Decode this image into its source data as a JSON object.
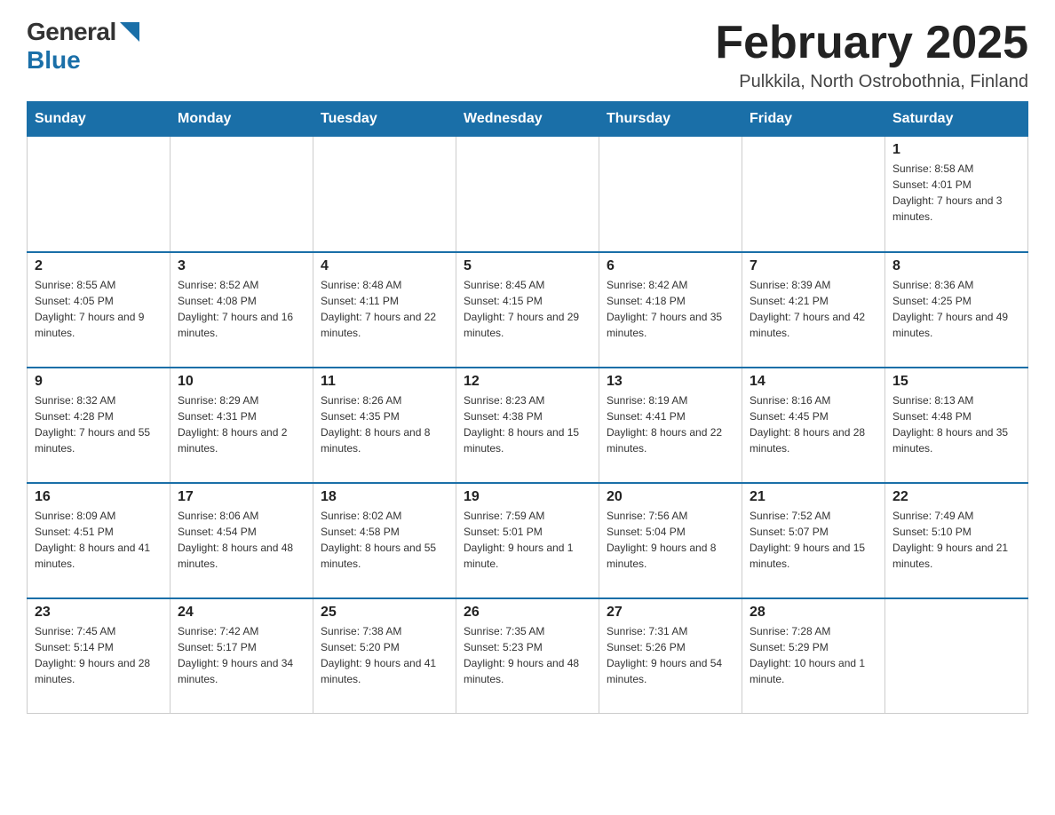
{
  "logo": {
    "general": "General",
    "blue": "Blue"
  },
  "header": {
    "title": "February 2025",
    "subtitle": "Pulkkila, North Ostrobothnia, Finland"
  },
  "weekdays": [
    "Sunday",
    "Monday",
    "Tuesday",
    "Wednesday",
    "Thursday",
    "Friday",
    "Saturday"
  ],
  "weeks": [
    [
      {
        "day": "",
        "info": ""
      },
      {
        "day": "",
        "info": ""
      },
      {
        "day": "",
        "info": ""
      },
      {
        "day": "",
        "info": ""
      },
      {
        "day": "",
        "info": ""
      },
      {
        "day": "",
        "info": ""
      },
      {
        "day": "1",
        "info": "Sunrise: 8:58 AM\nSunset: 4:01 PM\nDaylight: 7 hours and 3 minutes."
      }
    ],
    [
      {
        "day": "2",
        "info": "Sunrise: 8:55 AM\nSunset: 4:05 PM\nDaylight: 7 hours and 9 minutes."
      },
      {
        "day": "3",
        "info": "Sunrise: 8:52 AM\nSunset: 4:08 PM\nDaylight: 7 hours and 16 minutes."
      },
      {
        "day": "4",
        "info": "Sunrise: 8:48 AM\nSunset: 4:11 PM\nDaylight: 7 hours and 22 minutes."
      },
      {
        "day": "5",
        "info": "Sunrise: 8:45 AM\nSunset: 4:15 PM\nDaylight: 7 hours and 29 minutes."
      },
      {
        "day": "6",
        "info": "Sunrise: 8:42 AM\nSunset: 4:18 PM\nDaylight: 7 hours and 35 minutes."
      },
      {
        "day": "7",
        "info": "Sunrise: 8:39 AM\nSunset: 4:21 PM\nDaylight: 7 hours and 42 minutes."
      },
      {
        "day": "8",
        "info": "Sunrise: 8:36 AM\nSunset: 4:25 PM\nDaylight: 7 hours and 49 minutes."
      }
    ],
    [
      {
        "day": "9",
        "info": "Sunrise: 8:32 AM\nSunset: 4:28 PM\nDaylight: 7 hours and 55 minutes."
      },
      {
        "day": "10",
        "info": "Sunrise: 8:29 AM\nSunset: 4:31 PM\nDaylight: 8 hours and 2 minutes."
      },
      {
        "day": "11",
        "info": "Sunrise: 8:26 AM\nSunset: 4:35 PM\nDaylight: 8 hours and 8 minutes."
      },
      {
        "day": "12",
        "info": "Sunrise: 8:23 AM\nSunset: 4:38 PM\nDaylight: 8 hours and 15 minutes."
      },
      {
        "day": "13",
        "info": "Sunrise: 8:19 AM\nSunset: 4:41 PM\nDaylight: 8 hours and 22 minutes."
      },
      {
        "day": "14",
        "info": "Sunrise: 8:16 AM\nSunset: 4:45 PM\nDaylight: 8 hours and 28 minutes."
      },
      {
        "day": "15",
        "info": "Sunrise: 8:13 AM\nSunset: 4:48 PM\nDaylight: 8 hours and 35 minutes."
      }
    ],
    [
      {
        "day": "16",
        "info": "Sunrise: 8:09 AM\nSunset: 4:51 PM\nDaylight: 8 hours and 41 minutes."
      },
      {
        "day": "17",
        "info": "Sunrise: 8:06 AM\nSunset: 4:54 PM\nDaylight: 8 hours and 48 minutes."
      },
      {
        "day": "18",
        "info": "Sunrise: 8:02 AM\nSunset: 4:58 PM\nDaylight: 8 hours and 55 minutes."
      },
      {
        "day": "19",
        "info": "Sunrise: 7:59 AM\nSunset: 5:01 PM\nDaylight: 9 hours and 1 minute."
      },
      {
        "day": "20",
        "info": "Sunrise: 7:56 AM\nSunset: 5:04 PM\nDaylight: 9 hours and 8 minutes."
      },
      {
        "day": "21",
        "info": "Sunrise: 7:52 AM\nSunset: 5:07 PM\nDaylight: 9 hours and 15 minutes."
      },
      {
        "day": "22",
        "info": "Sunrise: 7:49 AM\nSunset: 5:10 PM\nDaylight: 9 hours and 21 minutes."
      }
    ],
    [
      {
        "day": "23",
        "info": "Sunrise: 7:45 AM\nSunset: 5:14 PM\nDaylight: 9 hours and 28 minutes."
      },
      {
        "day": "24",
        "info": "Sunrise: 7:42 AM\nSunset: 5:17 PM\nDaylight: 9 hours and 34 minutes."
      },
      {
        "day": "25",
        "info": "Sunrise: 7:38 AM\nSunset: 5:20 PM\nDaylight: 9 hours and 41 minutes."
      },
      {
        "day": "26",
        "info": "Sunrise: 7:35 AM\nSunset: 5:23 PM\nDaylight: 9 hours and 48 minutes."
      },
      {
        "day": "27",
        "info": "Sunrise: 7:31 AM\nSunset: 5:26 PM\nDaylight: 9 hours and 54 minutes."
      },
      {
        "day": "28",
        "info": "Sunrise: 7:28 AM\nSunset: 5:29 PM\nDaylight: 10 hours and 1 minute."
      },
      {
        "day": "",
        "info": ""
      }
    ]
  ]
}
